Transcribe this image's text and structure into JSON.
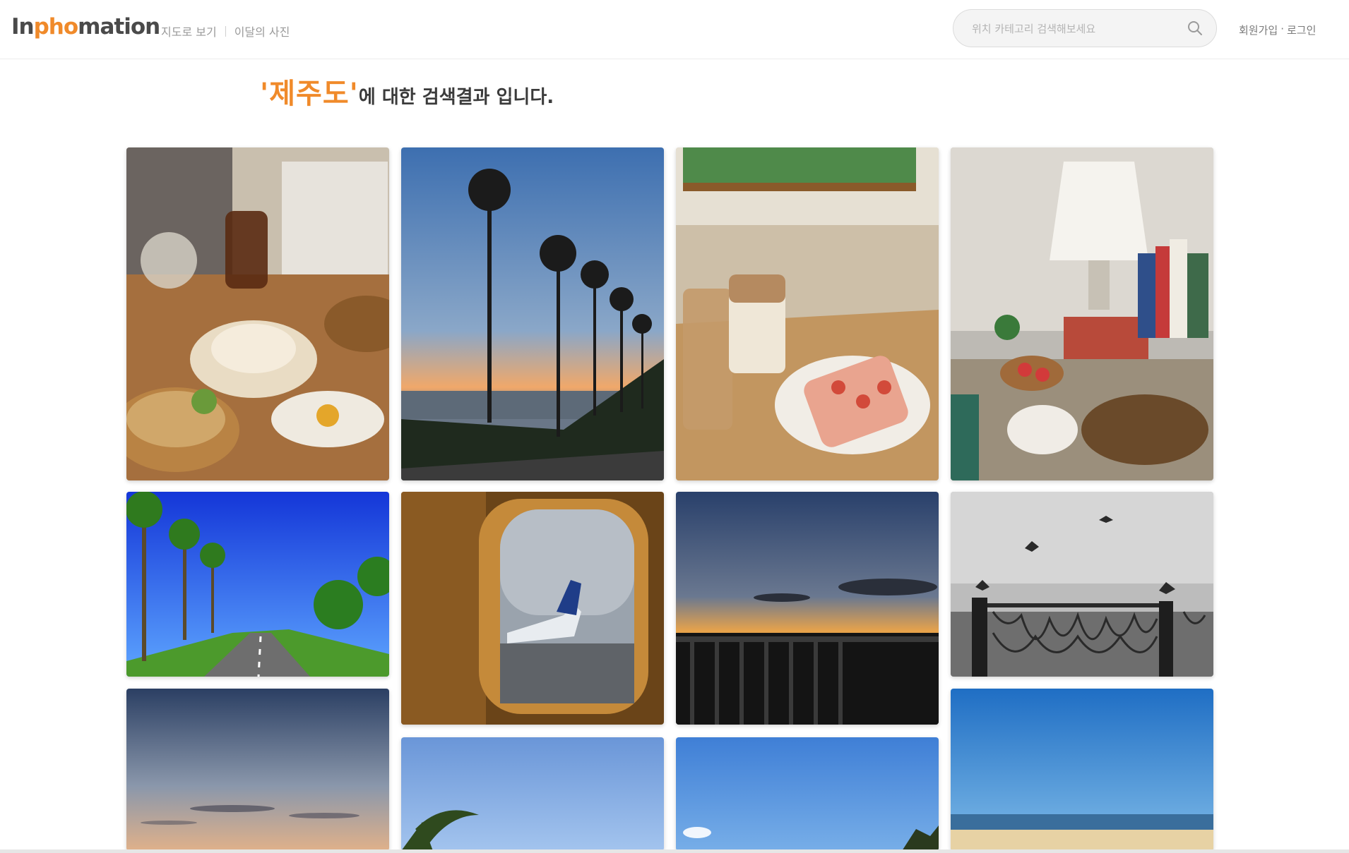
{
  "brand": {
    "logo_prefix": "In",
    "logo_accent": "pho",
    "logo_suffix": "mation",
    "accent_color": "#f08a2a"
  },
  "nav": {
    "map_view": "지도로 보기",
    "monthly_photo": "이달의 사진"
  },
  "search": {
    "placeholder": "위치 카테고리 검색해보세요"
  },
  "auth": {
    "signup": "회원가입",
    "separator": "·",
    "login": "로그인"
  },
  "results": {
    "query": "'제주도'",
    "suffix": "에 대한 검색결과 입니다."
  },
  "photos": [
    {
      "subject": "cafe-brunch-table"
    },
    {
      "subject": "palm-trees-sunset"
    },
    {
      "subject": "latte-strawberry-toast"
    },
    {
      "subject": "lamp-books-desk"
    },
    {
      "subject": "palm-lined-road"
    },
    {
      "subject": "airplane-window"
    },
    {
      "subject": "dusk-boardwalk-railing"
    },
    {
      "subject": "seagulls-bw-fence"
    },
    {
      "subject": "evening-sky"
    },
    {
      "subject": "blue-sky-palm"
    },
    {
      "subject": "blue-sky-clouds"
    },
    {
      "subject": "blue-sky-beach"
    }
  ]
}
